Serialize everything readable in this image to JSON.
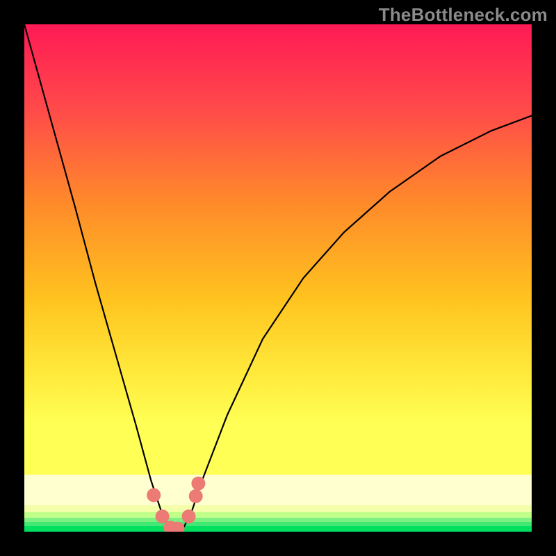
{
  "watermark": "TheBottleneck.com",
  "chart_data": {
    "type": "line",
    "title": "",
    "xlabel": "",
    "ylabel": "",
    "xlim": [
      0,
      100
    ],
    "ylim": [
      0,
      100
    ],
    "series": [
      {
        "name": "bottleneck-curve",
        "x": [
          0,
          5,
          10,
          14,
          18,
          22,
          25,
          27,
          28.5,
          30,
          31.5,
          33,
          35,
          40,
          47,
          55,
          63,
          72,
          82,
          92,
          100
        ],
        "y": [
          100,
          82,
          64,
          49,
          35,
          21,
          10,
          4,
          1,
          0,
          1,
          4,
          10,
          23,
          38,
          50,
          59,
          67,
          74,
          79,
          82
        ]
      }
    ],
    "threshold_band": {
      "y": 6
    },
    "markers": {
      "name": "highlight-points",
      "x": [
        25.5,
        27.2,
        28.8,
        30.2,
        32.4,
        33.8,
        34.3
      ],
      "y": [
        7.2,
        3.0,
        0.8,
        0.6,
        3.0,
        7.0,
        9.5
      ]
    },
    "colors": {
      "gradient_top": "#ff1a55",
      "gradient_mid1": "#ff7a2a",
      "gradient_mid2": "#ffd21f",
      "gradient_mid3": "#ffff4a",
      "gradient_band_pale": "#ffffcf",
      "gradient_bottom": "#00e060",
      "curve": "#000000",
      "marker": "#ec7a75"
    }
  }
}
